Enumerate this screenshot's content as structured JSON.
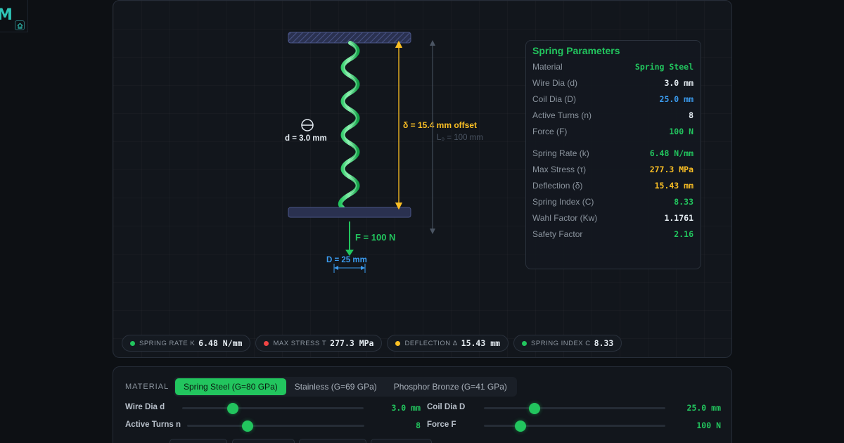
{
  "app": {
    "logo_letter": "M"
  },
  "diagram": {
    "wire_label": "d = 3.0 mm",
    "deflection_label": "δ = 15.4 mm offset",
    "free_length_label": "L₀ = 100 mm",
    "force_label": "F = 100 N",
    "coil_dia_label": "D = 25 mm"
  },
  "params": {
    "title": "Spring Parameters",
    "inputs": [
      {
        "label": "Material",
        "value": "Spring Steel",
        "color": "green"
      },
      {
        "label": "Wire Dia (d)",
        "value": "3.0 mm",
        "color": "white"
      },
      {
        "label": "Coil Dia (D)",
        "value": "25.0 mm",
        "color": "blue"
      },
      {
        "label": "Active Turns (n)",
        "value": "8",
        "color": "white"
      },
      {
        "label": "Force (F)",
        "value": "100 N",
        "color": "green"
      }
    ],
    "results": [
      {
        "label": "Spring Rate (k)",
        "value": "6.48 N/mm",
        "color": "green"
      },
      {
        "label": "Max Stress (τ)",
        "value": "277.3 MPa",
        "color": "yellow"
      },
      {
        "label": "Deflection (δ)",
        "value": "15.43 mm",
        "color": "yellow"
      },
      {
        "label": "Spring Index (C)",
        "value": "8.33",
        "color": "green"
      },
      {
        "label": "Wahl Factor (Kw)",
        "value": "1.1761",
        "color": "white"
      },
      {
        "label": "Safety Factor",
        "value": "2.16",
        "color": "green"
      }
    ]
  },
  "chips": [
    {
      "label": "SPRING RATE K",
      "value": "6.48 N/mm",
      "dot_color": "#22c55e"
    },
    {
      "label": "MAX STRESS Τ",
      "value": "277.3 MPa",
      "dot_color": "#ef4444"
    },
    {
      "label": "DEFLECTION Δ",
      "value": "15.43 mm",
      "dot_color": "#fbbf24"
    },
    {
      "label": "SPRING INDEX C",
      "value": "8.33",
      "dot_color": "#22c55e"
    }
  ],
  "controls": {
    "material_label": "MATERIAL",
    "materials": [
      {
        "label": "Spring Steel (G=80 GPa)",
        "active": true
      },
      {
        "label": "Stainless (G=69 GPa)",
        "active": false
      },
      {
        "label": "Phosphor Bronze (G=41 GPa)",
        "active": false
      }
    ],
    "sliders": [
      {
        "label": "Wire Dia d",
        "value": "3.0 mm",
        "level": 0.28
      },
      {
        "label": "Coil Dia D",
        "value": "25.0 mm",
        "level": 0.28
      },
      {
        "label": "Active Turns n",
        "value": "8",
        "level": 0.34
      },
      {
        "label": "Force F",
        "value": "100 N",
        "level": 0.2
      }
    ]
  },
  "colors": {
    "accent": "#22c55e",
    "blue": "#3b9cf0",
    "yellow": "#fbbf24",
    "red": "#ef4444"
  }
}
